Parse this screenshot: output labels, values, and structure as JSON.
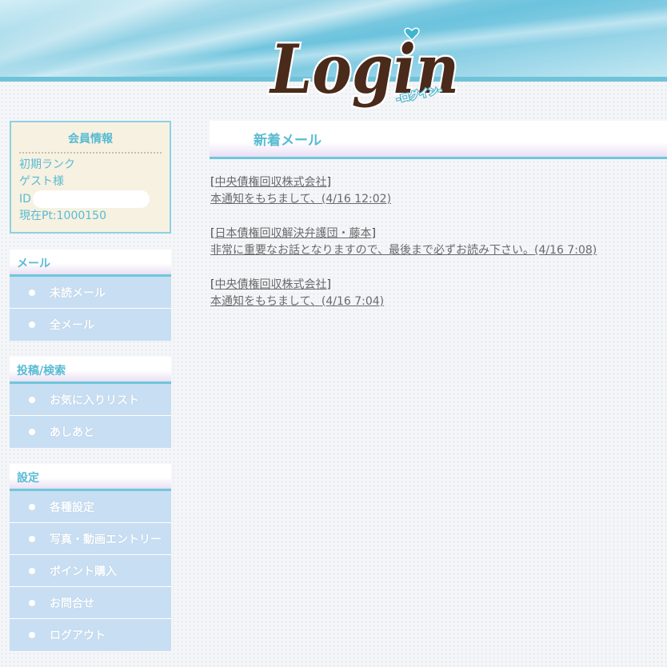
{
  "header": {
    "logo_main": "Login",
    "logo_sub": "-ログイン-"
  },
  "member": {
    "title": "会員情報",
    "rank": "初期ランク",
    "name": "ゲスト様",
    "id_label": "ID",
    "points": "現在Pt:1000150"
  },
  "nav": [
    {
      "heading": "メール",
      "items": [
        "未読メール",
        "全メール"
      ]
    },
    {
      "heading": "投稿/検索",
      "items": [
        "お気に入りリスト",
        "あしあと"
      ]
    },
    {
      "heading": "設定",
      "items": [
        "各種設定",
        "写真・動画エントリー",
        "ポイント購入",
        "お問合せ",
        "ログアウト"
      ]
    }
  ],
  "main": {
    "heading": "新着メール",
    "mails": [
      {
        "sender": "中央債権回収株式会社",
        "subject": "本通知をもちまして、(4/16 12:02)"
      },
      {
        "sender": "日本債権回収解決弁護団・藤本",
        "subject": "非常に重要なお話となりますので、最後まで必ずお読み下さい。(4/16 7:08)"
      },
      {
        "sender": "中央債権回収株式会社",
        "subject": "本通知をもちまして、(4/16 7:04)"
      }
    ]
  },
  "colors": {
    "accent": "#58bbd3",
    "nav_item_bg": "#c8def3",
    "member_bg": "#f7f1e1",
    "logo_brown": "#4a2a1a",
    "heart": "#3fb5cf"
  }
}
